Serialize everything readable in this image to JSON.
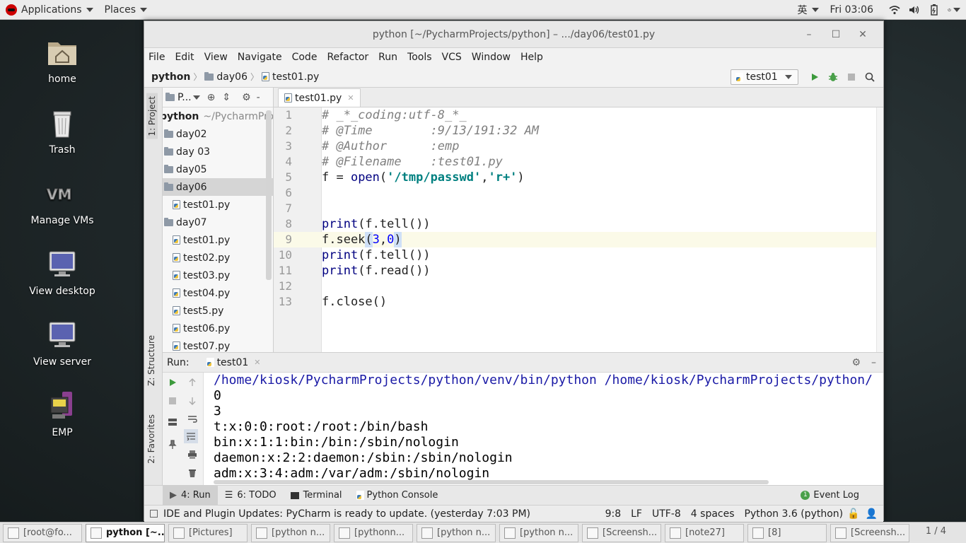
{
  "topbar": {
    "applications": "Applications",
    "places": "Places",
    "input_method": "英",
    "clock": "Fri 03:06"
  },
  "desktop": {
    "icons": [
      {
        "label": "home"
      },
      {
        "label": "Trash"
      },
      {
        "label": "Manage VMs"
      },
      {
        "label": "View desktop"
      },
      {
        "label": "View server"
      },
      {
        "label": "EMP"
      }
    ]
  },
  "window": {
    "title": "python [~/PycharmProjects/python] – .../day06/test01.py",
    "menu": [
      "File",
      "Edit",
      "View",
      "Navigate",
      "Code",
      "Refactor",
      "Run",
      "Tools",
      "VCS",
      "Window",
      "Help"
    ],
    "breadcrumb": [
      "python",
      "day06",
      "test01.py"
    ],
    "run_config": "test01"
  },
  "sidebar": {
    "project_tab": "1: Project",
    "structure_tab": "Z: Structure",
    "favorites_tab": "2: Favorites"
  },
  "project": {
    "view_label": "P...",
    "root": "python",
    "root_path": "~/PycharmProjects/python",
    "tree": [
      {
        "label": "day02",
        "type": "folder",
        "indent": 0
      },
      {
        "label": "day 03",
        "type": "folder",
        "indent": 0
      },
      {
        "label": "day05",
        "type": "folder",
        "indent": 0
      },
      {
        "label": "day06",
        "type": "folder",
        "indent": 0,
        "selected": true
      },
      {
        "label": "test01.py",
        "type": "file",
        "indent": 1
      },
      {
        "label": "day07",
        "type": "folder",
        "indent": 0
      },
      {
        "label": "test01.py",
        "type": "file",
        "indent": 1
      },
      {
        "label": "test02.py",
        "type": "file",
        "indent": 1
      },
      {
        "label": "test03.py",
        "type": "file",
        "indent": 1
      },
      {
        "label": "test04.py",
        "type": "file",
        "indent": 1
      },
      {
        "label": "test5.py",
        "type": "file",
        "indent": 1
      },
      {
        "label": "test06.py",
        "type": "file",
        "indent": 1
      },
      {
        "label": "test07.py",
        "type": "file",
        "indent": 1
      }
    ]
  },
  "editor": {
    "tab": "test01.py",
    "line_numbers": [
      "1",
      "2",
      "3",
      "4",
      "5",
      "6",
      "7",
      "8",
      "9",
      "10",
      "11",
      "12",
      "13"
    ],
    "code": {
      "l1": "# _*_coding:utf-8_*_",
      "l2": "# @Time        :9/13/191:32 AM",
      "l3": "# @Author      :emp",
      "l4": "# @Filename    :test01.py",
      "l5_a": "f = ",
      "l5_b": "open",
      "l5_c": "(",
      "l5_d": "'/tmp/passwd'",
      "l5_e": ",",
      "l5_f": "'r+'",
      "l5_g": ")",
      "l8_a": "print",
      "l8_b": "(f.tell())",
      "l9_a": "f.seek",
      "l9_b": "(",
      "l9_c": "3",
      "l9_d": ",",
      "l9_e": "0",
      "l9_f": ")",
      "l10_a": "print",
      "l10_b": "(f.tell())",
      "l11_a": "print",
      "l11_b": "(f.read())",
      "l13": "f.close()"
    }
  },
  "run": {
    "label": "Run:",
    "tab": "test01",
    "output": [
      "/home/kiosk/PycharmProjects/python/venv/bin/python /home/kiosk/PycharmProjects/python/",
      "0",
      "3",
      "t:x:0:0:root:/root:/bin/bash",
      "bin:x:1:1:bin:/bin:/sbin/nologin",
      "daemon:x:2:2:daemon:/sbin:/sbin/nologin",
      "adm:x:3:4:adm:/var/adm:/sbin/nologin"
    ]
  },
  "toolwindows": {
    "run": "4: Run",
    "todo": "6: TODO",
    "terminal": "Terminal",
    "console": "Python Console",
    "event_log": "Event Log",
    "event_count": "1"
  },
  "status": {
    "message": "IDE and Plugin Updates: PyCharm is ready to update. (yesterday 7:03 PM)",
    "position": "9:8",
    "line_sep": "LF",
    "encoding": "UTF-8",
    "indent": "4 spaces",
    "interpreter": "Python 3.6 (python)"
  },
  "taskbar": {
    "tasks": [
      "[root@fo...",
      "python [~...",
      "[Pictures]",
      "[python n...",
      "[pythonn...",
      "[python n...",
      "[python n...",
      "[Screensh...",
      "[note27]",
      "[8]",
      "[Screensh..."
    ],
    "workspace": "1 / 4"
  },
  "colors": {
    "comment": "#808080",
    "keyword": "#000080",
    "string": "#008080",
    "number": "#0000ff",
    "selection": "#cfe0f7",
    "run_green": "#3c9a3c"
  }
}
